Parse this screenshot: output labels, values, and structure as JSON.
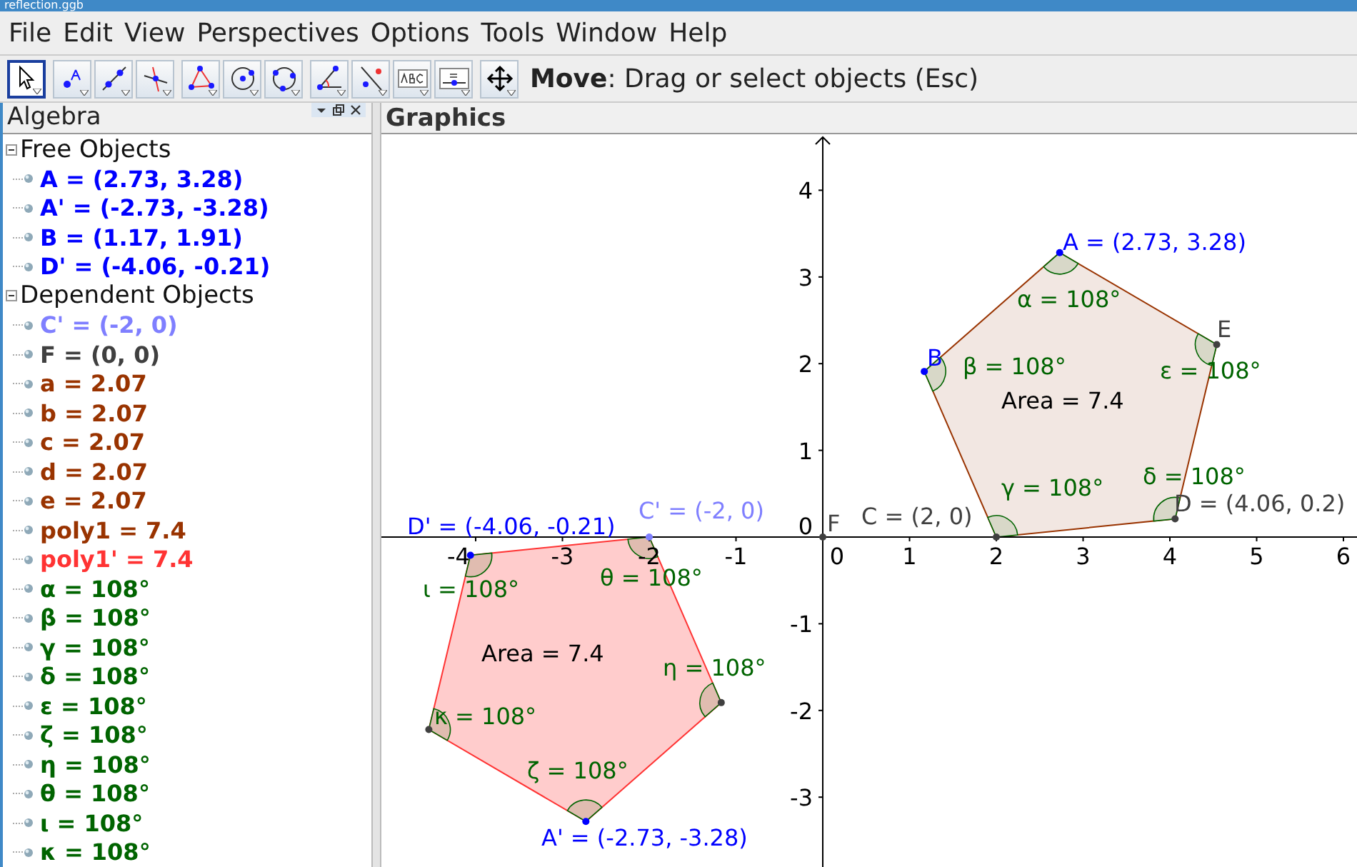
{
  "window": {
    "title": "reflection.ggb"
  },
  "menu": [
    "File",
    "Edit",
    "View",
    "Perspectives",
    "Options",
    "Tools",
    "Window",
    "Help"
  ],
  "toolbar": {
    "groups": [
      {
        "tools": [
          {
            "kind": "move",
            "selected": true
          }
        ]
      },
      {
        "tools": [
          {
            "kind": "point",
            "selected": false
          },
          {
            "kind": "line",
            "selected": false
          },
          {
            "kind": "perpendicular",
            "selected": false
          }
        ]
      },
      {
        "tools": [
          {
            "kind": "polygon",
            "selected": false
          },
          {
            "kind": "circle",
            "selected": false
          },
          {
            "kind": "conic",
            "selected": false
          }
        ]
      },
      {
        "tools": [
          {
            "kind": "angle",
            "selected": false
          },
          {
            "kind": "reflect",
            "selected": false
          },
          {
            "kind": "text",
            "selected": false
          },
          {
            "kind": "slider",
            "selected": false
          }
        ]
      },
      {
        "tools": [
          {
            "kind": "move-view",
            "selected": false
          }
        ]
      }
    ],
    "help": "**Move**: Drag or select objects (Esc)"
  },
  "algebra": {
    "title": "Algebra",
    "groups": [
      {
        "label": "Free Objects",
        "expanded": true,
        "children": [
          {
            "text": "A = (2.73, 3.28)",
            "color": "#0000ff"
          },
          {
            "text": "A' = (-2.73, -3.28)",
            "color": "#0000ff"
          },
          {
            "text": "B = (1.17, 1.91)",
            "color": "#0000ff"
          },
          {
            "text": "D' = (-4.06, -0.21)",
            "color": "#0000ff"
          }
        ]
      },
      {
        "label": "Dependent Objects",
        "expanded": true,
        "children": [
          {
            "text": "C' = (-2, 0)",
            "color": "#7f7fff"
          },
          {
            "text": "F = (0, 0)",
            "color": "#404040"
          },
          {
            "text": "a = 2.07",
            "color": "#993300"
          },
          {
            "text": "b = 2.07",
            "color": "#993300"
          },
          {
            "text": "c = 2.07",
            "color": "#993300"
          },
          {
            "text": "d = 2.07",
            "color": "#993300"
          },
          {
            "text": "e = 2.07",
            "color": "#993300"
          },
          {
            "text": "poly1 = 7.4",
            "color": "#993300"
          },
          {
            "text": "poly1' = 7.4",
            "color": "#ff3333"
          },
          {
            "text": "α = 108°",
            "color": "#006400"
          },
          {
            "text": "β = 108°",
            "color": "#006400"
          },
          {
            "text": "γ = 108°",
            "color": "#006400"
          },
          {
            "text": "δ = 108°",
            "color": "#006400"
          },
          {
            "text": "ε = 108°",
            "color": "#006400"
          },
          {
            "text": "ζ = 108°",
            "color": "#006400"
          },
          {
            "text": "η = 108°",
            "color": "#006400"
          },
          {
            "text": "θ = 108°",
            "color": "#006400"
          },
          {
            "text": "ι = 108°",
            "color": "#006400"
          },
          {
            "text": "κ = 108°",
            "color": "#006400"
          }
        ]
      }
    ]
  },
  "graphics": {
    "title": "Graphics",
    "x_tick_labels": [
      "-4",
      "-3",
      "-2",
      "-1",
      "0",
      "1",
      "2",
      "3",
      "4",
      "5",
      "6"
    ],
    "y_tick_labels": [
      "4",
      "3",
      "2",
      "1",
      "0",
      "-1",
      "-2",
      "-3"
    ],
    "labels": [
      {
        "text": "A = (2.73, 3.28)",
        "color": "#0000ff"
      },
      {
        "text": "α = 108°",
        "color": "#006400"
      },
      {
        "text": "E",
        "color": "#404040"
      },
      {
        "text": "B",
        "color": "#0000ff"
      },
      {
        "text": "β = 108°",
        "color": "#006400"
      },
      {
        "text": "ε = 108°",
        "color": "#006400"
      },
      {
        "text": "Area = 7.4",
        "color": "#000000"
      },
      {
        "text": "δ = 108°",
        "color": "#006400"
      },
      {
        "text": "γ = 108°",
        "color": "#006400"
      },
      {
        "text": "D' = (-4.06, -0.21)",
        "color": "#0000ff"
      },
      {
        "text": "C' = (-2, 0)",
        "color": "#7f7fff"
      },
      {
        "text": "F",
        "color": "#404040"
      },
      {
        "text": "C = (2, 0)",
        "color": "#404040"
      },
      {
        "text": "D = (4.06, 0.2)",
        "color": "#404040"
      },
      {
        "text": "θ = 108°",
        "color": "#006400"
      },
      {
        "text": "ι = 108°",
        "color": "#006400"
      },
      {
        "text": "Area = 7.4",
        "color": "#000000"
      },
      {
        "text": "η = 108°",
        "color": "#006400"
      },
      {
        "text": "κ = 108°",
        "color": "#006400"
      },
      {
        "text": "ζ = 108°",
        "color": "#006400"
      },
      {
        "text": "A' = (-2.73, -3.28)",
        "color": "#0000ff"
      }
    ]
  }
}
